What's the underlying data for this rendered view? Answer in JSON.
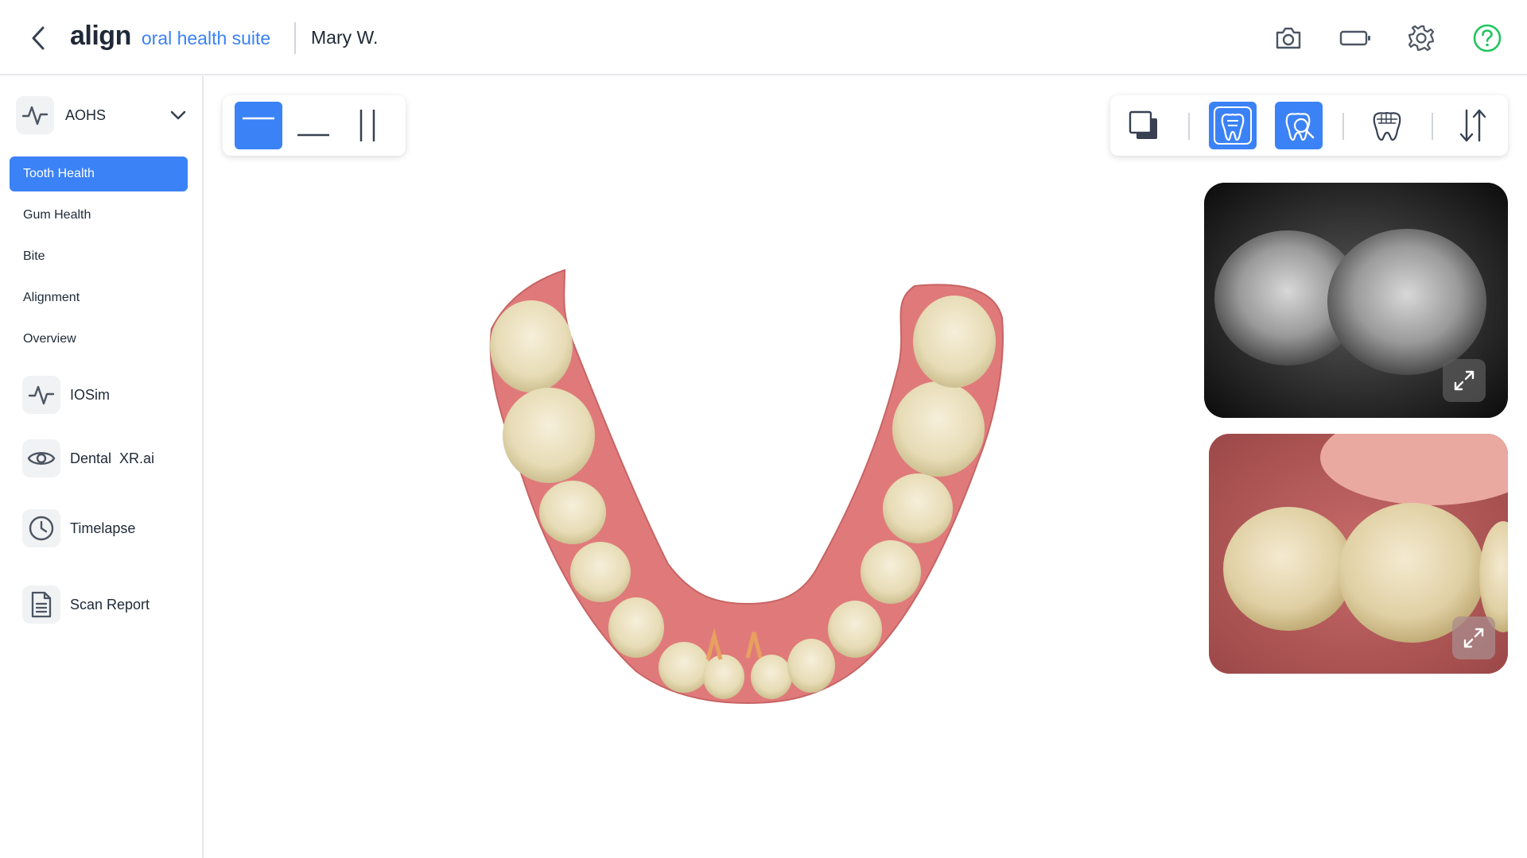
{
  "header": {
    "brand_name": "align",
    "brand_suite": "oral health suite",
    "patient_name": "Mary W."
  },
  "sidebar": {
    "section": {
      "label": "AOHS",
      "expanded": true
    },
    "sub_items": [
      {
        "label": "Tooth Health",
        "active": true
      },
      {
        "label": "Gum Health",
        "active": false
      },
      {
        "label": "Bite",
        "active": false
      },
      {
        "label": "Alignment",
        "active": false
      },
      {
        "label": "Overview",
        "active": false
      }
    ],
    "tools": [
      {
        "label": "IOSim",
        "icon": "activity-icon"
      },
      {
        "label": "Dental  XR.ai",
        "icon": "eye-icon"
      },
      {
        "label": "Timelapse",
        "icon": "clock-icon"
      },
      {
        "label": "Scan Report",
        "icon": "document-icon"
      }
    ]
  },
  "layout_toolbar": {
    "options": [
      "single-view",
      "horizontal-split",
      "vertical-split"
    ],
    "selected": "single-view"
  },
  "view_toolbar": {
    "options": [
      "overlay",
      "nir-tooth",
      "intraoral-camera",
      "tooth-model",
      "flip-jaw"
    ],
    "active": [
      "nir-tooth",
      "intraoral-camera"
    ]
  },
  "colors": {
    "accent": "#3b82f6",
    "help": "#22c55e",
    "icon_gray": "#4b5563",
    "gum": "#e07a7a",
    "tooth": "#ede3c2"
  }
}
